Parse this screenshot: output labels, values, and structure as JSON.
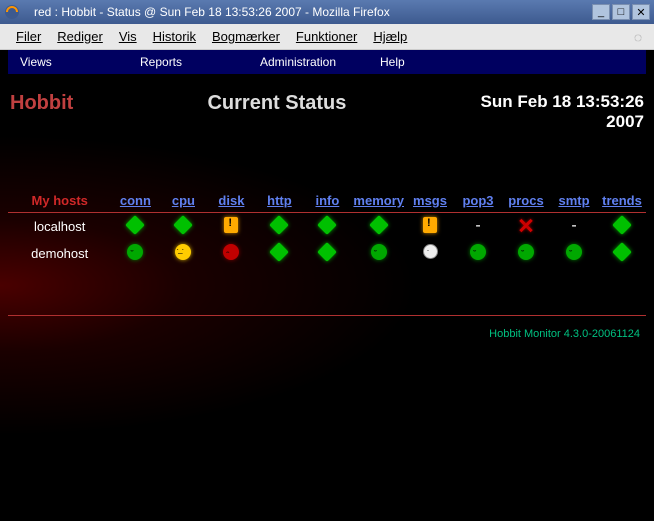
{
  "window": {
    "title": "red : Hobbit - Status @ Sun Feb 18 13:53:26 2007 - Mozilla Firefox"
  },
  "browser_menu": {
    "items": [
      "Filer",
      "Rediger",
      "Vis",
      "Historik",
      "Bogmærker",
      "Funktioner",
      "Hjælp"
    ]
  },
  "nav": {
    "items": [
      "Views",
      "Reports",
      "Administration",
      "Help"
    ]
  },
  "header": {
    "brand": "Hobbit",
    "title": "Current Status",
    "timestamp_line1": "Sun Feb 18 13:53:26",
    "timestamp_line2": "2007"
  },
  "section": {
    "label": "My hosts"
  },
  "columns": [
    "conn",
    "cpu",
    "disk",
    "http",
    "info",
    "memory",
    "msgs",
    "pop3",
    "procs",
    "smtp",
    "trends"
  ],
  "hosts": [
    {
      "name": "localhost",
      "cells": [
        "green-diamond",
        "green-diamond",
        "yellow-bang",
        "green-diamond",
        "green-diamond",
        "green-diamond",
        "yellow-bang",
        "dash",
        "red-x",
        "dash",
        "green-diamond"
      ]
    },
    {
      "name": "demohost",
      "cells": [
        "green-face",
        "yellow-face",
        "red-face",
        "green-diamond",
        "green-diamond",
        "green-face",
        "white-face",
        "green-face",
        "green-face",
        "green-face",
        "green-diamond"
      ]
    }
  ],
  "footer": {
    "text": "Hobbit Monitor 4.3.0-20061124"
  }
}
